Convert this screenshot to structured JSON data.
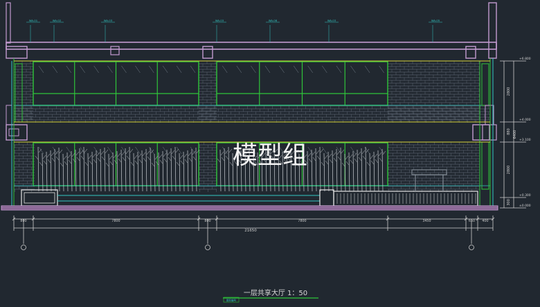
{
  "drawing": {
    "title": "一层共享大厅  1：50",
    "title_tag": "图名编号",
    "watermark": "模型组",
    "colors": {
      "background": "#212830",
      "slab": "#c39ad0",
      "slab_dark": "#7d5a86",
      "glass_frame": "#2fc53a",
      "yellow": "#d8d23a",
      "cyan": "#32c9c4",
      "masonry": "#6a7380",
      "dim": "#cfcfcf",
      "white": "#e6e6e6"
    },
    "tags": [
      "WA-01",
      "WA-02",
      "WA-03",
      "WA-03",
      "WA-08",
      "WA-03",
      "WA-05"
    ],
    "segment_dims": [
      "800",
      "7800",
      "800",
      "7800",
      "3450",
      "650",
      "400"
    ],
    "total_dim": "21650",
    "height_dims": [
      "2800",
      "880",
      "2800",
      "300"
    ],
    "total_height": "6400",
    "levels": [
      "+6.800",
      "+4.000",
      "+3.100",
      "+0.300",
      "±0.000"
    ]
  }
}
